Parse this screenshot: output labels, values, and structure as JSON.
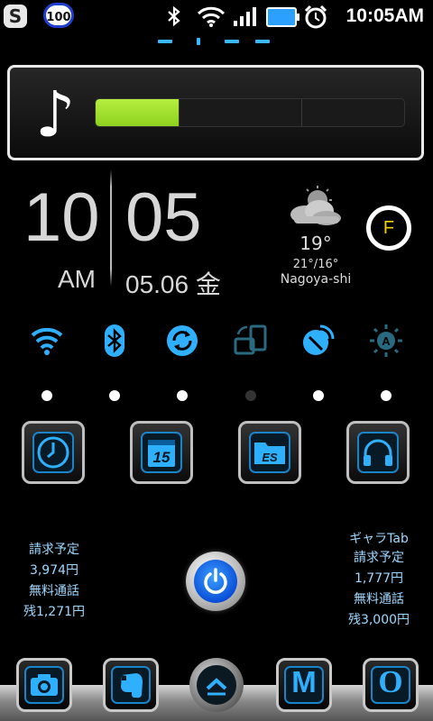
{
  "status_bar": {
    "s_icon_letter": "S",
    "notification_count": "100",
    "time": "10:05AM",
    "icons": [
      "bluetooth-icon",
      "wifi-icon",
      "signal-icon",
      "battery-icon",
      "alarm-icon"
    ]
  },
  "music": {
    "note_glyph": "♪",
    "progress": 0.27,
    "progress_color": "#8ed11f"
  },
  "clock": {
    "hour": "10",
    "minute": "05",
    "ampm": "AM",
    "date": "05.06",
    "weekday": "金"
  },
  "weather": {
    "icon": "cloudy-sun-icon",
    "temp": "19°",
    "range": "21°/16°",
    "city": "Nagoya-shi"
  },
  "f_button": {
    "label": "F",
    "color": "#f0d000"
  },
  "toggles": [
    {
      "name": "wifi-toggle",
      "icon": "wifi-icon",
      "on": true
    },
    {
      "name": "bluetooth-toggle",
      "icon": "bluetooth-icon",
      "on": true
    },
    {
      "name": "sync-toggle",
      "icon": "sync-icon",
      "on": true
    },
    {
      "name": "rotation-toggle",
      "icon": "screen-rotation-icon",
      "on": false
    },
    {
      "name": "gps-toggle",
      "icon": "gps-icon",
      "on": true
    },
    {
      "name": "brightness-toggle",
      "icon": "auto-brightness-icon",
      "on": true
    }
  ],
  "apps": {
    "calendar_day": "15",
    "es_label": "ES"
  },
  "billing_left": {
    "line1": "請求予定",
    "line2": "3,974円",
    "line3": "無料通話",
    "line4": "残1,271円"
  },
  "billing_right": {
    "line0": "ギャラTab",
    "line1": "請求予定",
    "line2": "1,777円",
    "line3": "無料通話",
    "line4": "残3,000円"
  },
  "dock": {
    "gmail_letter": "M",
    "opera_letter": "O"
  },
  "colors": {
    "accent": "#2fb0ff",
    "dim": "#2a6a80"
  }
}
